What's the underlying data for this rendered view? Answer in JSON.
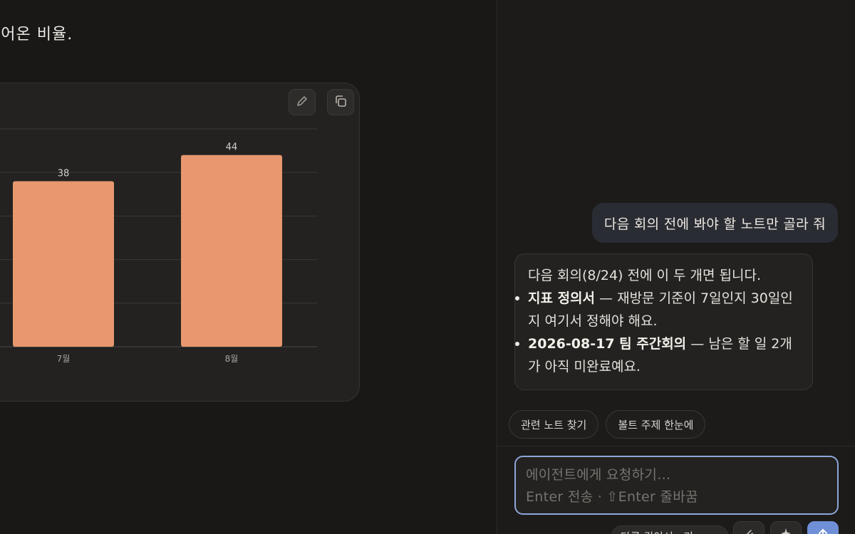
{
  "doc": {
    "text": "들어온 비율."
  },
  "chart_card": {
    "edit_icon": "pencil-icon",
    "copy_icon": "copy-icon"
  },
  "chart_data": {
    "type": "bar",
    "categories": [
      "7월",
      "8월"
    ],
    "values": [
      38,
      44
    ],
    "data_labels": [
      "38",
      "44"
    ],
    "color": "#e8976e",
    "ylim": [
      0,
      50
    ],
    "grid": true,
    "title": "",
    "xlabel": "",
    "ylabel": ""
  },
  "chat": {
    "user_message": "다음 회의 전에 봐야 할 노트만 골라 줘",
    "agent_message": {
      "intro": "다음 회의(8/24) 전에 이 두 개면 됩니다.",
      "items": [
        {
          "title": "지표 정의서",
          "text": " — 재방문 기준이 7일인지 30일인지 여기서 정해야 해요."
        },
        {
          "title": "2026-08-17 팀 주간회의",
          "text": " — 남은 할 일 2개가 아직 미완료예요."
        }
      ]
    },
    "chips": [
      "관련 노트 찾기",
      "볼트 주제 한눈에"
    ]
  },
  "composer": {
    "placeholder_line1": "에이전트에게 요청하기…",
    "placeholder_line2": "Enter 전송 · ⇧Enter 줄바꿈"
  },
  "bottom_bar": {
    "model_label": "다른 깊이서 · 기",
    "attach_icon": "paperclip-icon",
    "spark_icon": "sparkle-icon",
    "send_icon": "arrow-up-icon",
    "send_color": "#6f8fd6"
  },
  "colors": {
    "accent": "#8ea6d8",
    "bar": "#e8976e"
  }
}
